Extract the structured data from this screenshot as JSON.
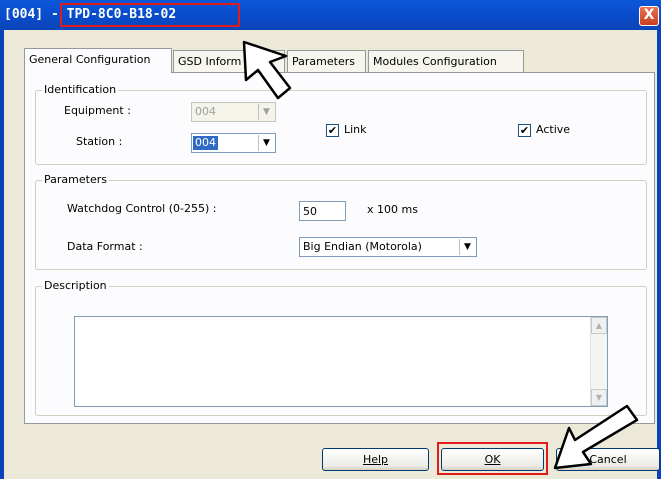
{
  "window": {
    "id_prefix": "[004] - ",
    "name": "TPD-8C0-B18-02",
    "close_glyph": "X"
  },
  "tabs": [
    {
      "label": "General Configuration",
      "active": true
    },
    {
      "label": "GSD Inform",
      "active": false
    },
    {
      "label": "Parameters",
      "active": false
    },
    {
      "label": "Modules Configuration",
      "active": false
    }
  ],
  "identification": {
    "title": "Identification",
    "equipment_label": "Equipment :",
    "equipment_value": "004",
    "station_label": "Station :",
    "station_value": "004",
    "link_label": "Link",
    "link_checked": true,
    "active_label": "Active",
    "active_checked": true
  },
  "parameters": {
    "title": "Parameters",
    "watchdog_label": "Watchdog Control (0-255) :",
    "watchdog_value": "50",
    "watchdog_unit": "x 100 ms",
    "format_label": "Data Format :",
    "format_value": "Big Endian (Motorola)"
  },
  "description": {
    "title": "Description",
    "value": ""
  },
  "buttons": {
    "help": "Help",
    "ok": "OK",
    "cancel": "Cancel"
  },
  "colors": {
    "titlebar": "#0a4fd0",
    "highlight": "#e21a1a",
    "selection": "#316ac5"
  }
}
